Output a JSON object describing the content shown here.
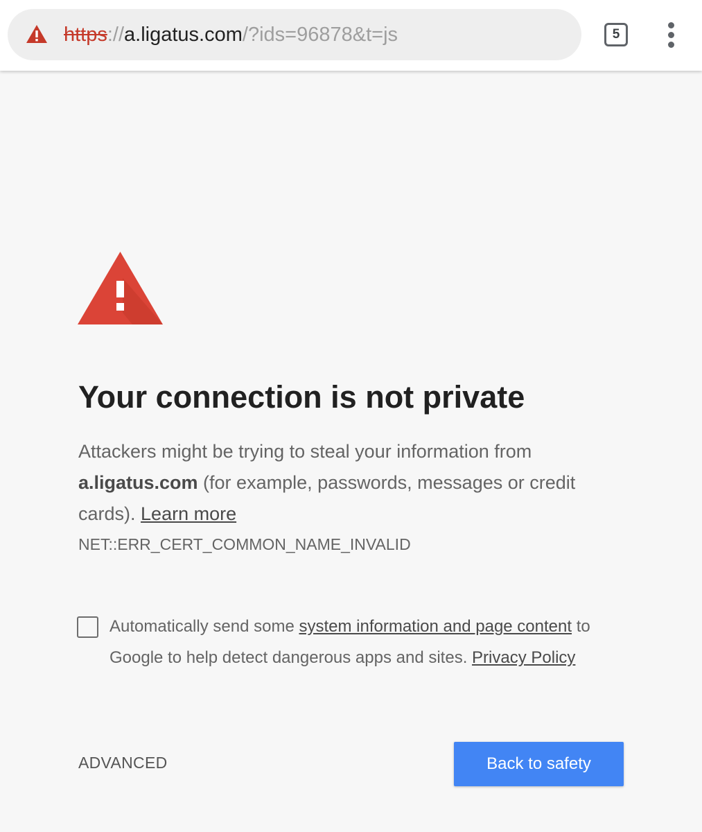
{
  "toolbar": {
    "url_scheme": "https",
    "url_separator": "://",
    "url_host": "a.ligatus.com",
    "url_path": "/?ids=96878&t=js",
    "tab_count": "5",
    "menu_icon": "more-vert-icon",
    "security_icon": "warning-triangle-icon"
  },
  "interstitial": {
    "heading": "Your connection is not private",
    "body_intro": "Attackers might be trying to steal your information from ",
    "body_host": "a.ligatus.com",
    "body_rest": " (for example, passwords, messages or credit cards). ",
    "learn_more": "Learn more",
    "error_code": "NET::ERR_CERT_COMMON_NAME_INVALID",
    "optin_prefix": "Automatically send some ",
    "optin_link": "system information and page content",
    "optin_middle": " to Google to help detect dangerous apps and sites. ",
    "privacy_link": "Privacy Policy",
    "optin_checked": false,
    "advanced_label": "ADVANCED",
    "back_button_label": "Back to safety"
  },
  "colors": {
    "warning_red": "#db4437",
    "scheme_red": "#c53929",
    "primary_button": "#4285f4",
    "page_background": "#f7f7f7"
  }
}
